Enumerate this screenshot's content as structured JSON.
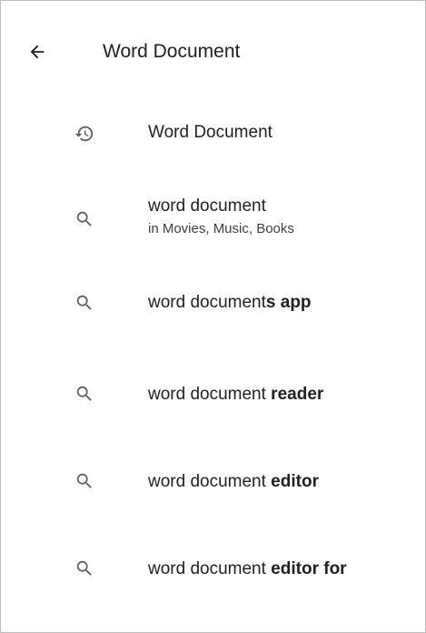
{
  "search": {
    "query": "Word Document"
  },
  "suggestions": [
    {
      "type": "history",
      "icon": "history-icon",
      "base": "Word Document",
      "rest": "",
      "sub": ""
    },
    {
      "type": "search",
      "icon": "search-icon",
      "base": "word document",
      "rest": "",
      "sub": "in Movies, Music, Books"
    },
    {
      "type": "search",
      "icon": "search-icon",
      "base": "word document",
      "rest": "s app",
      "sub": ""
    },
    {
      "type": "search",
      "icon": "search-icon",
      "base": "word document",
      "rest": " reader",
      "sub": ""
    },
    {
      "type": "search",
      "icon": "search-icon",
      "base": "word document",
      "rest": " editor",
      "sub": ""
    },
    {
      "type": "search",
      "icon": "search-icon",
      "base": "word document",
      "rest": " editor for",
      "sub": ""
    }
  ],
  "colors": {
    "text": "#202124",
    "icon": "#5f6368",
    "subtext": "#3c4043",
    "border": "#bdbdbd"
  }
}
